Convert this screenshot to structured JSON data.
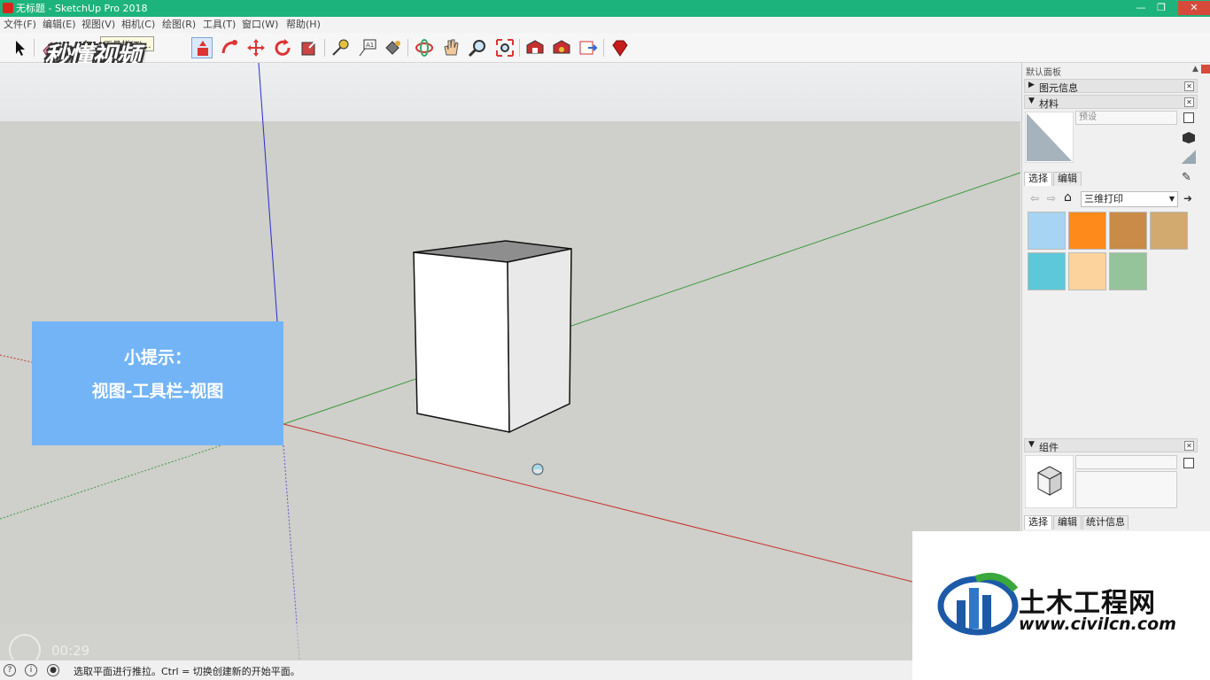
{
  "window": {
    "title": "无标题 - SketchUp Pro 2018"
  },
  "menubar": [
    "文件(F)",
    "编辑(E)",
    "视图(V)",
    "相机(C)",
    "绘图(R)",
    "工具(T)",
    "窗口(W)",
    "帮助(H)"
  ],
  "toolbar": {
    "tooltip": "工具栏(T)...",
    "tools": [
      "select-tool",
      "eraser-tool",
      "pencil-tool",
      "push-pull-tool",
      "follow-me-tool",
      "move-tool",
      "rotate-tool",
      "scale-tool",
      "tape-measure-tool",
      "text-tool",
      "paint-bucket-tool",
      "orbit-tool",
      "pan-tool",
      "zoom-tool",
      "zoom-extents-tool",
      "warehouse-tool",
      "extension-warehouse-tool",
      "send-to-layout-tool",
      "ruby-tool"
    ]
  },
  "watermark": "秒懂视频",
  "tip": {
    "title": "小提示：",
    "body": "视图-工具栏-视图"
  },
  "video": {
    "time": "00:29"
  },
  "panel": {
    "header": "默认面板",
    "entity_info": "图元信息",
    "materials": {
      "title": "材料",
      "name_placeholder": "预设",
      "tabs": [
        "选择",
        "编辑"
      ],
      "library": "三维打印",
      "swatches": [
        "#a6d4f2",
        "#ff8a1c",
        "#c98b47",
        "#d2a96e",
        "#5cc8d9",
        "#fcd39c",
        "#95c39a"
      ]
    },
    "components": {
      "title": "组件",
      "tabs": [
        "选择",
        "编辑",
        "统计信息"
      ]
    }
  },
  "status": {
    "message": "选取平面进行推拉。Ctrl = 切换创建新的开始平面。"
  },
  "logo": {
    "name": "土木工程网",
    "url": "www.civilcn.com"
  }
}
